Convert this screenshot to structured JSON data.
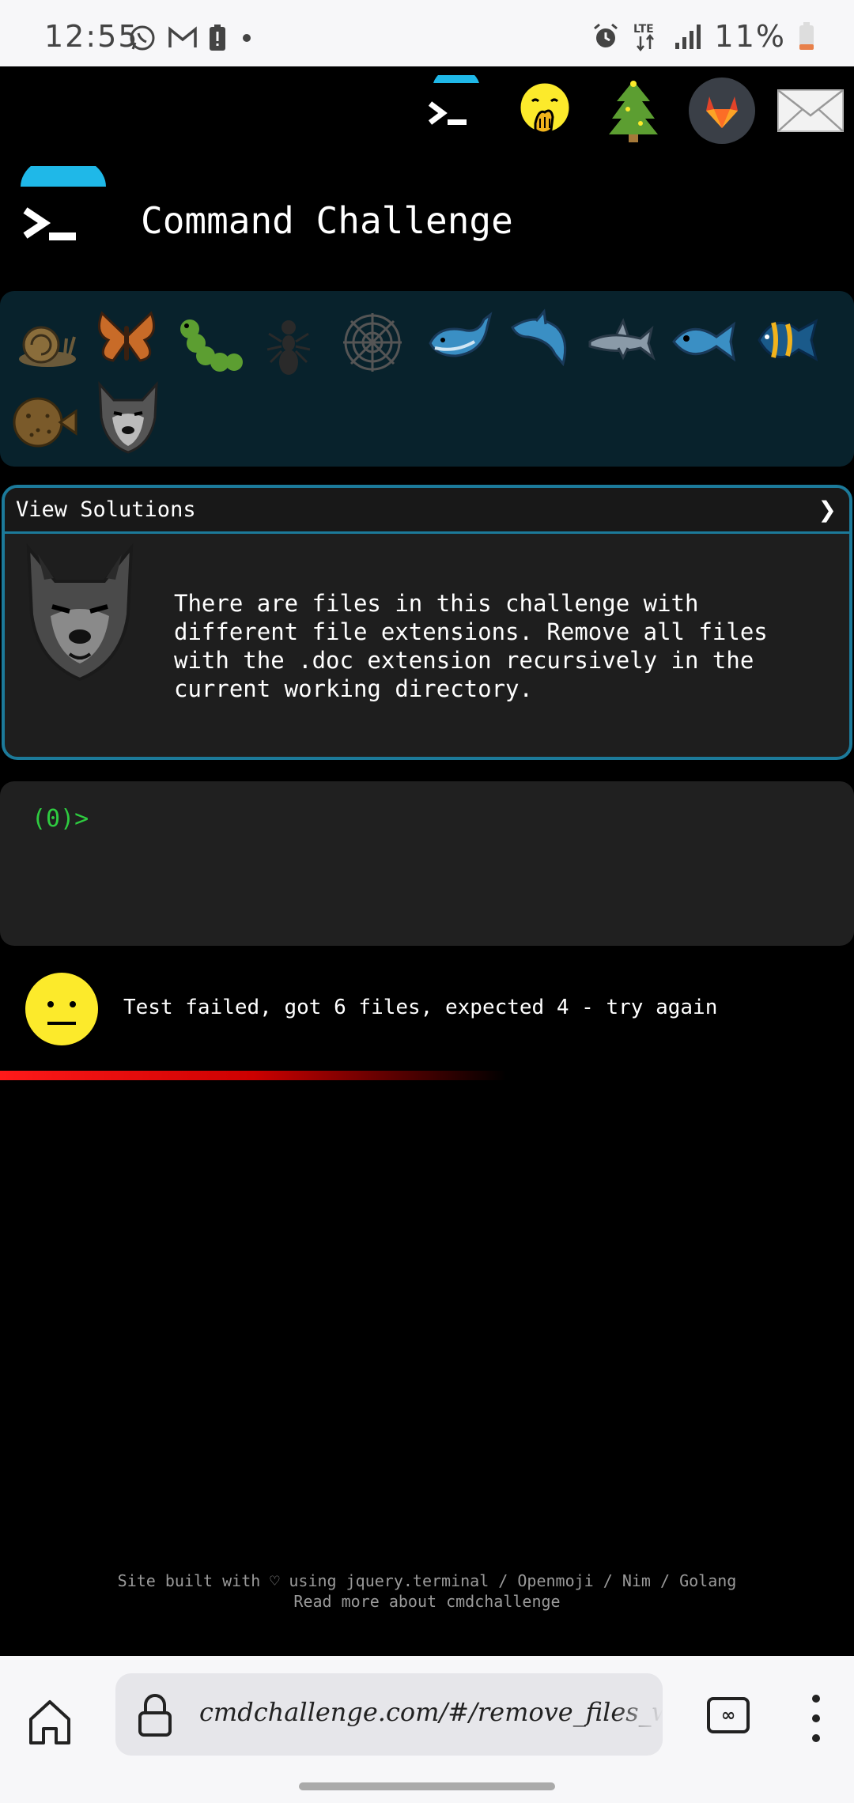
{
  "status_bar": {
    "time": "12:55",
    "battery_percent": "11%",
    "network": "LTE",
    "icons": [
      "whatsapp-icon",
      "gmail-icon",
      "battery-alert-icon",
      "dot-icon",
      "alarm-icon",
      "lte-icon",
      "signal-icon",
      "battery-icon"
    ]
  },
  "top_icons": [
    "terminal-icon",
    "hand-over-mouth-emoji-icon",
    "christmas-tree-icon",
    "gitlab-icon",
    "mail-icon"
  ],
  "header": {
    "title": "Command Challenge"
  },
  "creatures": [
    "snail-icon",
    "butterfly-icon",
    "caterpillar-icon",
    "ant-icon",
    "spider-web-icon",
    "whale-icon",
    "dolphin-icon",
    "shark-icon",
    "fish-icon",
    "tropical-fish-icon",
    "blowfish-icon",
    "wolf-icon"
  ],
  "challenge": {
    "view_solutions_label": "View Solutions",
    "chevron": "❯",
    "description": "There are files in this challenge with\ndifferent file extensions. Remove all files\nwith the .doc extension recursively in the\ncurrent working directory."
  },
  "terminal": {
    "prompt": "(0)>"
  },
  "result": {
    "message": "Test failed, got 6 files, expected 4 - try again"
  },
  "footer": {
    "line1": "Site built with ♡ using jquery.terminal / Openmoji / Nim / Golang",
    "line2": "Read more about cmdchallenge"
  },
  "browser": {
    "url": "cmdchallenge.com/#/remove_files_with_extension"
  },
  "colors": {
    "accent": "#1c7a9a",
    "prompt": "#2ecc40",
    "error": "#ff1a1a",
    "header_arc": "#1fb8e8"
  }
}
